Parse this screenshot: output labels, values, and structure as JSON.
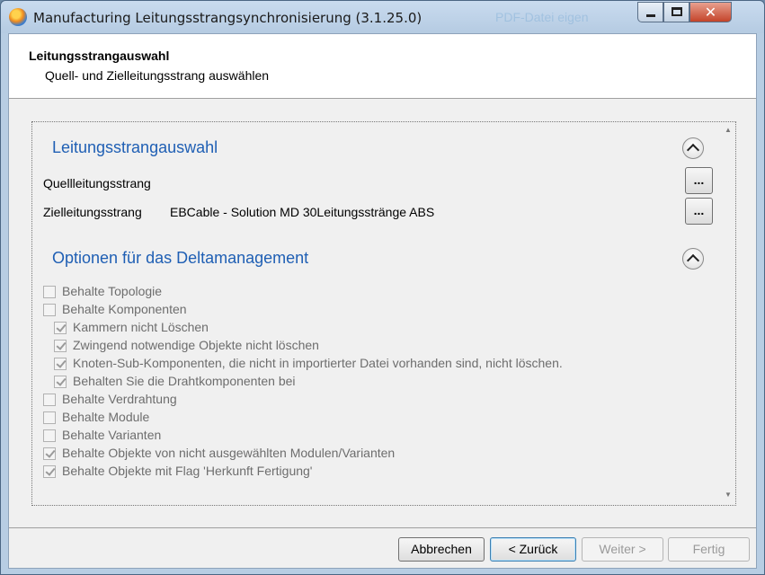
{
  "window": {
    "title": "Manufacturing Leitungsstrangsynchronisierung (3.1.25.0)",
    "background_app_text": "PDF-Datei eigen"
  },
  "header": {
    "title": "Leitungsstrangauswahl",
    "subtitle": "Quell- und Zielleitungsstrang auswählen"
  },
  "section_selection": {
    "title": "Leitungsstrangauswahl",
    "source_label": "Quellleitungsstrang",
    "source_value": "",
    "target_label": "Zielleitungsstrang",
    "target_value": "EBCable - Solution MD 30Leitungsstränge ABS",
    "browse_label": "..."
  },
  "section_options": {
    "title": "Optionen für das Deltamanagement",
    "options": [
      {
        "label": "Behalte Topologie",
        "checked": false,
        "indent": 0
      },
      {
        "label": "Behalte Komponenten",
        "checked": false,
        "indent": 0
      },
      {
        "label": "Kammern nicht Löschen",
        "checked": true,
        "indent": 1
      },
      {
        "label": "Zwingend notwendige Objekte nicht löschen",
        "checked": true,
        "indent": 1
      },
      {
        "label": "Knoten-Sub-Komponenten, die nicht in importierter Datei vorhanden sind, nicht löschen.",
        "checked": true,
        "indent": 1
      },
      {
        "label": "Behalten Sie die Drahtkomponenten bei",
        "checked": true,
        "indent": 1
      },
      {
        "label": "Behalte Verdrahtung",
        "checked": false,
        "indent": 0
      },
      {
        "label": "Behalte Module",
        "checked": false,
        "indent": 0
      },
      {
        "label": "Behalte Varianten",
        "checked": false,
        "indent": 0
      },
      {
        "label": "Behalte Objekte von nicht ausgewählten Modulen/Varianten",
        "checked": true,
        "indent": 0
      },
      {
        "label": "Behalte Objekte mit Flag 'Herkunft Fertigung'",
        "checked": true,
        "indent": 0
      }
    ]
  },
  "footer": {
    "cancel": "Abbrechen",
    "back": "< Zurück",
    "next": "Weiter >",
    "finish": "Fertig"
  },
  "colors": {
    "section_title": "#1f5fb4",
    "disabled_text": "#6d6d6d"
  }
}
